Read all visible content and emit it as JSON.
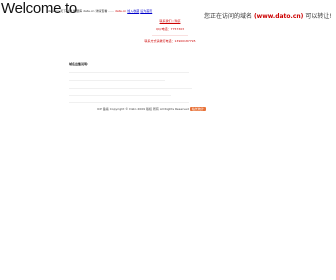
{
  "header": {
    "welcome": "Welcome to",
    "tag_text": "data.cn 天下站群 数据库 data.cn 详情查看 ......",
    "tag_red": "data.cn",
    "tag_link1": "加入收藏",
    "tag_link2": "设为首页"
  },
  "banner": {
    "prefix": "您正在访问的域名",
    "domain": "(www.dato.cn)",
    "suffix": "可以转让!"
  },
  "center": {
    "links": "联系我们 | 购买",
    "phone": "QQ/电话：7757303",
    "line3": "………………………………",
    "contact": "联系方式请拨打电话：13900187795"
  },
  "content": {
    "heading": "域名出售说明:",
    "para1": "…………………………………………………………………………………………………………",
    "para2": "……………………………………………………………………………………",
    "para3": "……………………………………………………………………………………………………………",
    "para4": "…………………………………………………………………………………………",
    "para5": "…………………………………………………………………………………………………………"
  },
  "footer": {
    "text": "ICP 备案 Copyright © Dato 2009 版权 所有 All Rights Reserved",
    "badge": "站长统计"
  }
}
